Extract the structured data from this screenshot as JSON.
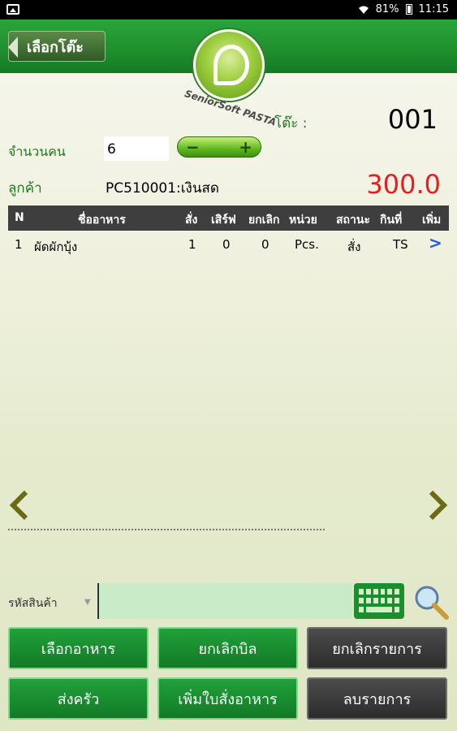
{
  "status_bar": {
    "battery": "81%",
    "time": "11:15"
  },
  "header": {
    "back_label": "เลือกโต๊ะ",
    "logo_text": "SeniorSoft PASTA"
  },
  "order": {
    "table_label": "โต๊ะ :",
    "table_no": "001",
    "people_label": "จำนวนคน",
    "people_value": "6",
    "customer_label": "ลูกค้า",
    "customer_value": "PC510001:เงินสด",
    "total": "300.0"
  },
  "table": {
    "headers": [
      "N",
      "ชื่ออาหาร",
      "สั่ง",
      "เสิร์ฟ",
      "ยกเลิก",
      "หน่วย",
      "สถานะ",
      "กินที่",
      "เพิ่ม"
    ],
    "rows": [
      {
        "n": "1",
        "name": "ผัดผักบุ้ง",
        "ordered": "1",
        "served": "0",
        "cancelled": "0",
        "unit": "Pcs.",
        "status": "สั่ง",
        "eat": "TS",
        "more": ">"
      }
    ]
  },
  "search": {
    "label": "รหัสสินค้า",
    "value": ""
  },
  "buttons": {
    "select_food": "เลือกอาหาร",
    "cancel_bill": "ยกเลิกบิล",
    "cancel_item": "ยกเลิกรายการ",
    "send_kitchen": "ส่งครัว",
    "add_order_sheet": "เพิ่มใบสั่งอาหาร",
    "delete_item": "ลบรายการ"
  },
  "colors": {
    "header_green": "#1f8e2e",
    "label_green": "#1f7a1f",
    "total_red": "#e51e1e"
  }
}
